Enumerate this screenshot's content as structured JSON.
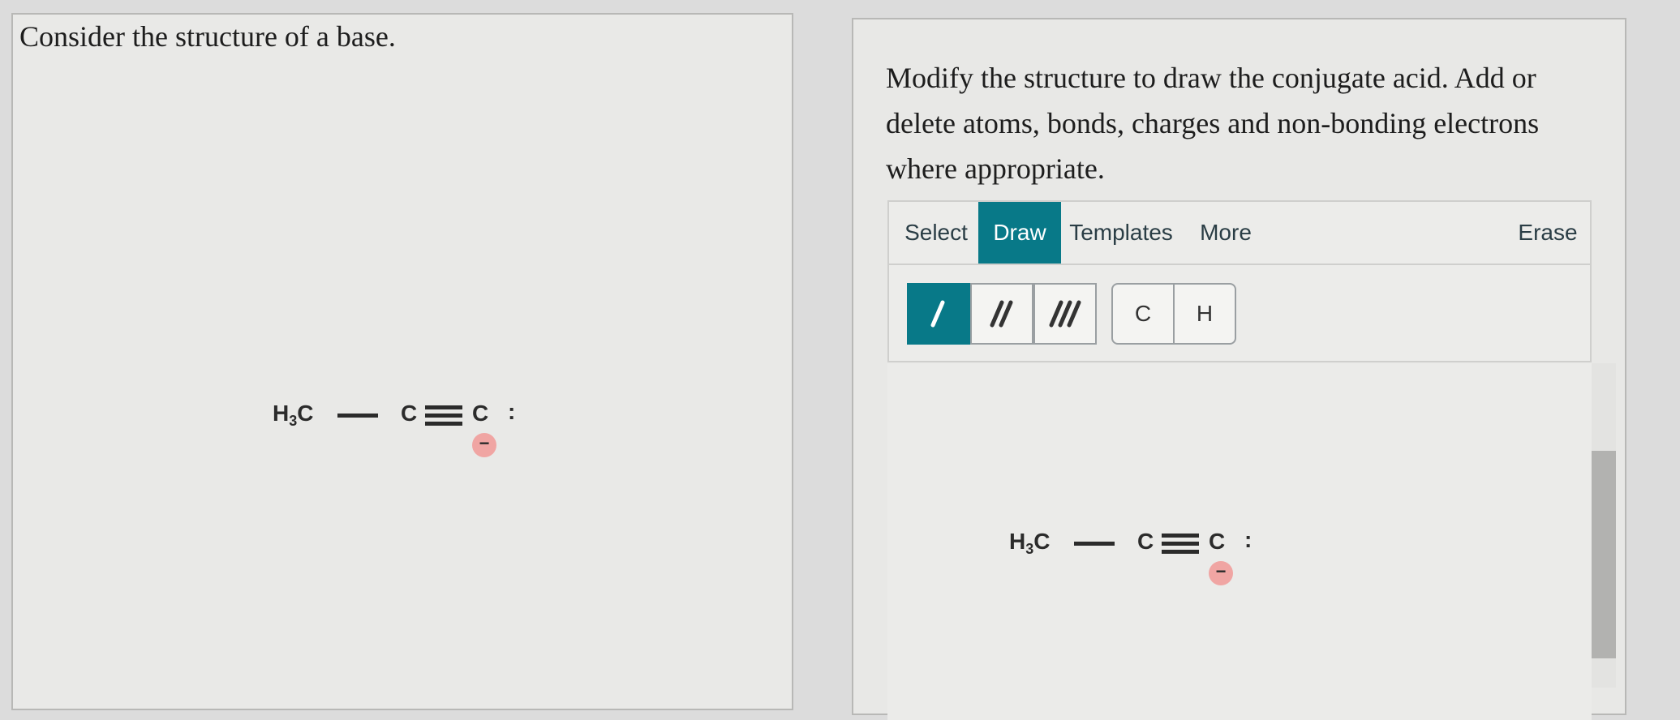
{
  "left_panel": {
    "prompt": "Consider the structure of a base.",
    "molecule": {
      "group": "H",
      "group_sub": "3",
      "group_tail": "C",
      "atom2": "C",
      "atom3": "C",
      "lone_pair": ":",
      "charge": "−"
    }
  },
  "right_panel": {
    "prompt": "Modify the structure to draw the conjugate acid. Add or delete atoms, bonds, charges and non-bonding electrons where appropriate.",
    "tabs": {
      "select": "Select",
      "draw": "Draw",
      "templates": "Templates",
      "more": "More",
      "erase": "Erase"
    },
    "tools": {
      "atom_c": "C",
      "atom_h": "H"
    },
    "molecule": {
      "group": "H",
      "group_sub": "3",
      "group_tail": "C",
      "atom2": "C",
      "atom3": "C",
      "lone_pair": ":",
      "charge": "−"
    }
  },
  "colors": {
    "accent": "#087988",
    "charge": "#f0a5a3"
  }
}
